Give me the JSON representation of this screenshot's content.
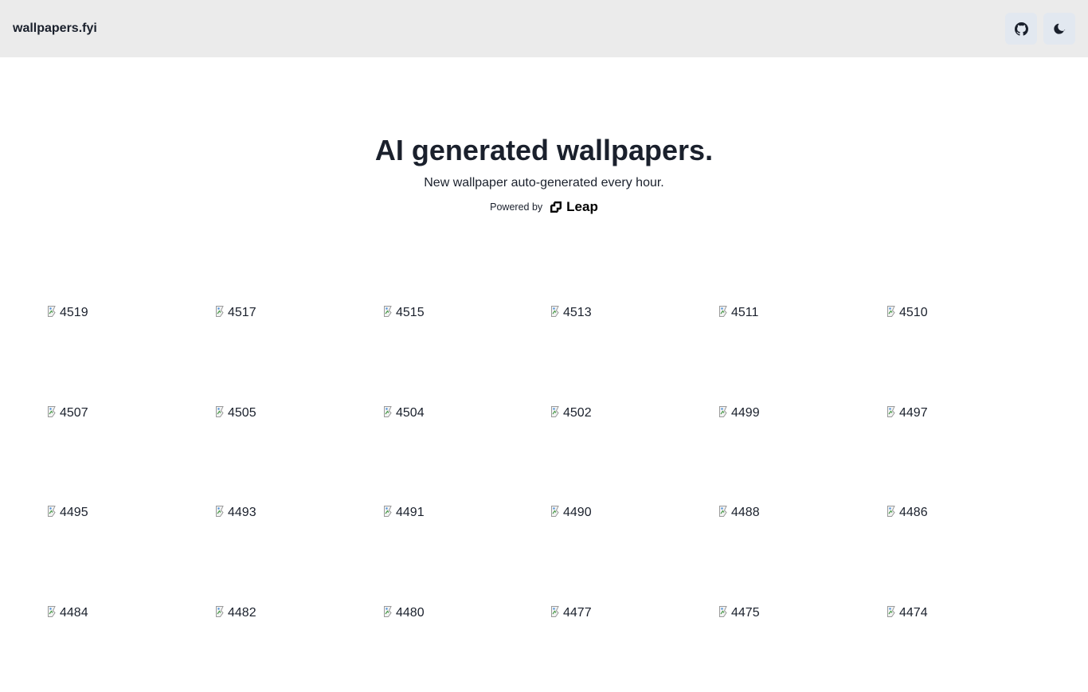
{
  "header": {
    "site_name": "wallpapers.fyi",
    "github_icon": "github-icon",
    "theme_icon": "moon-icon"
  },
  "hero": {
    "title": "AI generated wallpapers.",
    "subtitle": "New wallpaper auto-generated every hour.",
    "powered_by": "Powered by",
    "brand": "Leap",
    "brand_icon": "leap-logo-icon"
  },
  "gallery": {
    "items": [
      "4519",
      "4517",
      "4515",
      "4513",
      "4511",
      "4510",
      "4507",
      "4505",
      "4504",
      "4502",
      "4499",
      "4497",
      "4495",
      "4493",
      "4491",
      "4490",
      "4488",
      "4486",
      "4484",
      "4482",
      "4480",
      "4477",
      "4475",
      "4474"
    ]
  },
  "colors": {
    "header_bg": "#ebebeb",
    "button_bg": "#e2e8f0",
    "text": "#1a202c"
  }
}
